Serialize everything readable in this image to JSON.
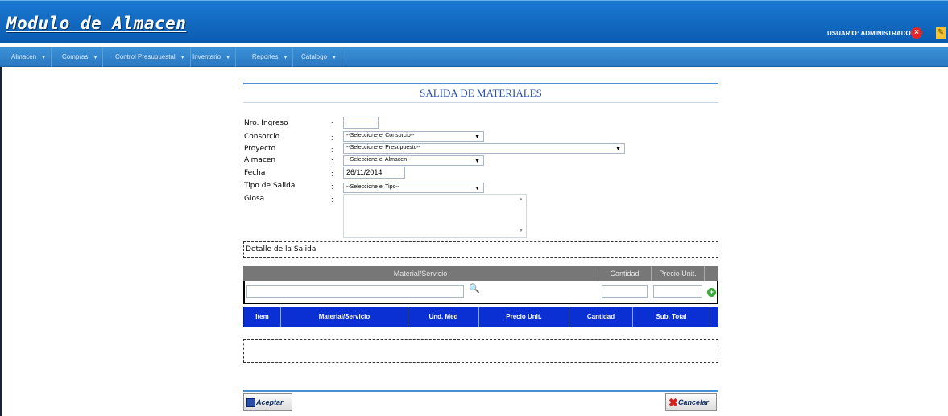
{
  "header": {
    "app_title": "Modulo de Almacen",
    "user_label": "USUARIO: ADMINISTRADOR",
    "logout_icon": "close-icon",
    "edit_icon": "pencil-icon"
  },
  "menu": {
    "items": [
      {
        "label": "Almacen"
      },
      {
        "label": "Compras"
      },
      {
        "label": "Control Presupuestal"
      },
      {
        "label": "Inventario"
      },
      {
        "label": "Reportes"
      },
      {
        "label": "Catalogo"
      }
    ]
  },
  "form": {
    "title": "SALIDA DE MATERIALES",
    "fields": {
      "nro_ingreso": {
        "label": "Nro. Ingreso",
        "value": ""
      },
      "consorcio": {
        "label": "Consorcio",
        "value": "--Seleccione el Consorcio--"
      },
      "proyecto": {
        "label": "Proyecto",
        "value": "--Seleccione el Presupuesto--"
      },
      "almacen": {
        "label": "Almacen",
        "value": "--Seleccione el Almacen--"
      },
      "fecha": {
        "label": "Fecha",
        "value": "26/11/2014"
      },
      "tipo_salida": {
        "label": "Tipo de Salida",
        "value": "--Seleccione el Tipo--"
      },
      "glosa": {
        "label": "Glosa",
        "value": ""
      }
    },
    "colon": ":"
  },
  "detail": {
    "title": "Detalle de la Salida",
    "entry_columns": [
      "Material/Servicio",
      "Cantidad",
      "Precio Unit."
    ],
    "grid_columns": [
      "Item",
      "Material/Servicio",
      "Und. Med",
      "Precio Unit.",
      "Cantidad",
      "Sub. Total"
    ]
  },
  "actions": {
    "accept_label": "Aceptar",
    "cancel_label": "Cancelar"
  },
  "colors": {
    "header_blue": "#0b5cb0",
    "grid_header_blue": "#0a30d4",
    "rule_blue": "#4a8fd9"
  }
}
